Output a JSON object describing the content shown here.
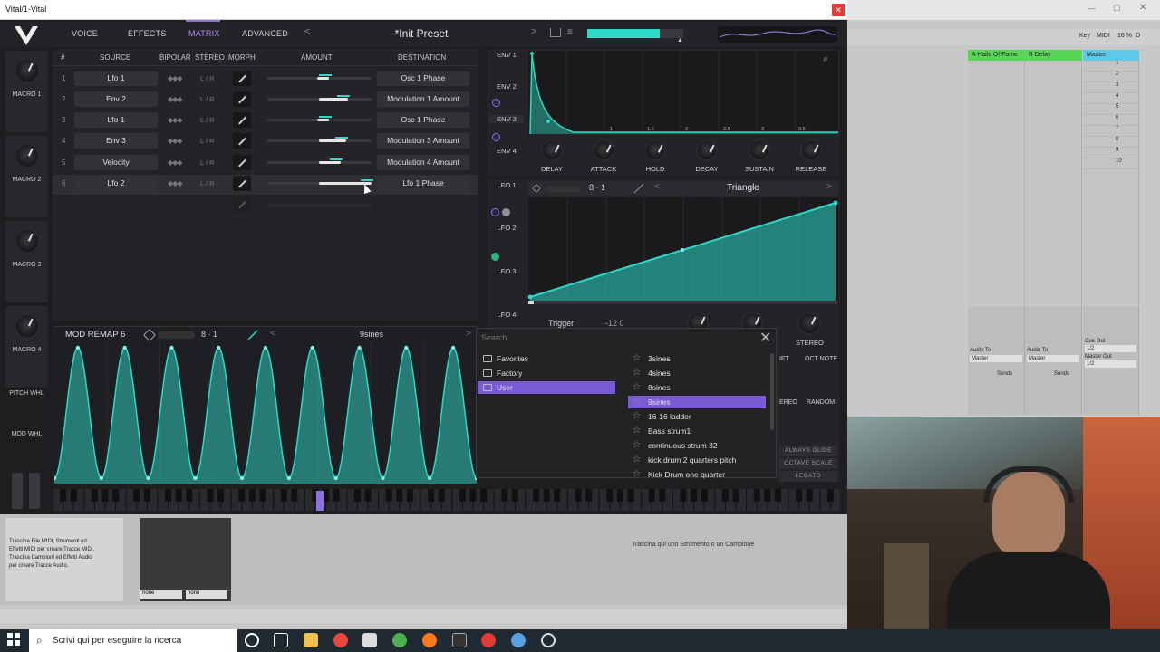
{
  "window": {
    "title": "Vital/1-Vital",
    "close_glyph": "✕"
  },
  "nav": {
    "tabs": [
      "VOICE",
      "EFFECTS",
      "MATRIX",
      "ADVANCED"
    ],
    "preset": "*Init Preset"
  },
  "macros": {
    "labels": [
      "MACRO 1",
      "MACRO 2",
      "MACRO 3",
      "MACRO 4"
    ],
    "pitch": "PITCH WHL",
    "mod": "MOD WHL"
  },
  "matrix": {
    "headers": {
      "num": "#",
      "source": "SOURCE",
      "bipolar": "BIPOLAR",
      "stereo": "STEREO",
      "morph": "MORPH",
      "amount": "AMOUNT",
      "destination": "DESTINATION"
    },
    "rows": [
      {
        "n": "1",
        "source": "Lfo 1",
        "dest": "Osc 1 Phase",
        "amount": 0.55
      },
      {
        "n": "2",
        "source": "Env 2",
        "dest": "Modulation 1 Amount",
        "amount": 0.72
      },
      {
        "n": "3",
        "source": "Lfo 1",
        "dest": "Osc 1 Phase",
        "amount": 0.55
      },
      {
        "n": "4",
        "source": "Env 3",
        "dest": "Modulation 3 Amount",
        "amount": 0.7
      },
      {
        "n": "5",
        "source": "Velocity",
        "dest": "Modulation 4 Amount",
        "amount": 0.65
      },
      {
        "n": "6",
        "source": "Lfo 2",
        "dest": "Lfo 1 Phase",
        "amount": 0.95
      }
    ],
    "bipolar_glyph": "◆◆◆",
    "lr_text": "L / R"
  },
  "remap": {
    "title": "MOD REMAP 6",
    "tempo": "8 · 1",
    "shape": "9sines",
    "left_arrow": "<",
    "right_arrow": ">"
  },
  "env": {
    "tabs": [
      "ENV 1",
      "ENV 2",
      "ENV 3",
      "ENV 4"
    ],
    "knobs": [
      "DELAY",
      "ATTACK",
      "HOLD",
      "DECAY",
      "SUSTAIN",
      "RELEASE"
    ],
    "time_labels": [
      "1",
      "1.5",
      "2",
      "2.5",
      "3",
      "3.5"
    ]
  },
  "lfo": {
    "tabs": [
      "LFO 1",
      "LFO 2",
      "LFO 3",
      "LFO 4"
    ],
    "tempo": "8 · 1",
    "shape": "Triangle",
    "trigger": "Trigger",
    "values": "-12   0",
    "stereo": "STEREO"
  },
  "voice_right": {
    "ift": "IFT",
    "oct_note": "OCT NOTE",
    "ereo": "EREO",
    "random": "RANDOM",
    "buttons": [
      "ALWAYS GLIDE",
      "OCTAVE SCALE",
      "LEGATO"
    ]
  },
  "browser": {
    "search_placeholder": "Search",
    "close_glyph": "✕",
    "folders": [
      "Favorites",
      "Factory",
      "User"
    ],
    "selected_folder": 2,
    "presets": [
      "3sines",
      "4sines",
      "8sines",
      "9sines",
      "16-16 ladder",
      "Bass strum1",
      "continuous strum 32",
      "kick drum 2 quarters pitch",
      "Kick Drum one quarter"
    ],
    "selected_preset": 3
  },
  "ableton": {
    "tracks": [
      "A Hails Of Fame",
      "B Delay",
      "Master"
    ],
    "scene_numbers": [
      "1",
      "2",
      "3",
      "4",
      "5",
      "6",
      "7",
      "8",
      "9",
      "10"
    ],
    "audio_to": "Audio To",
    "master": "Master",
    "sends": "Sends",
    "cue_out": "Cue Out",
    "master_out": "Master Out",
    "routing": "1/2",
    "info_text": [
      "Trascina File MIDI, Strumenti ed",
      "Effetti MIDI per creare Tracce MIDI.",
      "Trascina Campioni ed Effetti Audio",
      "per creare Tracce Audio."
    ],
    "drop_text": "Trascina qui uno Strumento o un Campione",
    "none": "none",
    "toolbar_key": "Key",
    "toolbar_midi": "MIDI",
    "toolbar_pct": "16 %",
    "toolbar_d": "D"
  },
  "taskbar": {
    "search_text": "Scrivi qui per eseguire la ricerca"
  },
  "colors": {
    "accent": "#2fd8c6",
    "purple": "#7a5bd6",
    "bg": "#1e1e20"
  }
}
